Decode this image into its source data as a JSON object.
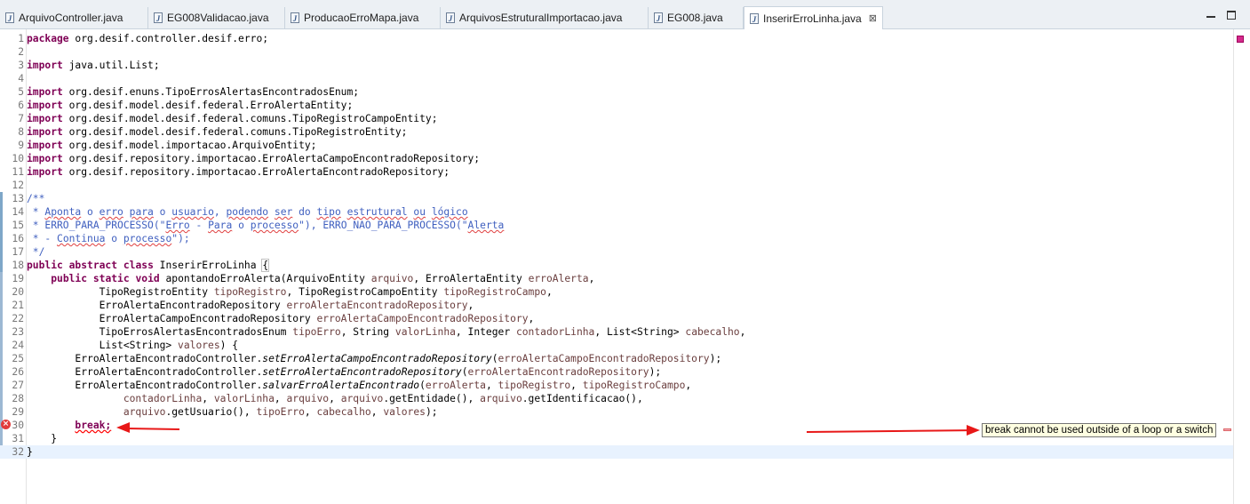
{
  "tabs": [
    {
      "label": "ArquivoController.java",
      "icon": "java-file-icon",
      "active": false
    },
    {
      "label": "EG008Validacao.java",
      "icon": "java-file-icon",
      "active": false
    },
    {
      "label": "ProducaoErroMapa.java",
      "icon": "java-file-icon",
      "active": false
    },
    {
      "label": "ArquivosEstruturalImportacao.java",
      "icon": "java-file-icon",
      "active": false
    },
    {
      "label": "EG008.java",
      "icon": "java-file-icon",
      "active": false
    },
    {
      "label": "InserirErroLinha.java",
      "icon": "java-file-icon",
      "active": true,
      "close": "⊠"
    }
  ],
  "editor": {
    "error_line": 30,
    "error_tooltip": "break cannot be used outside of a loop or a switch",
    "lines": [
      [
        [
          "kw",
          "package"
        ],
        [
          "t",
          " org.desif.controller.desif.erro;"
        ]
      ],
      [],
      [
        [
          "kw",
          "import"
        ],
        [
          "t",
          " java.util.List;"
        ]
      ],
      [],
      [
        [
          "kw",
          "import"
        ],
        [
          "t",
          " org.desif.enuns.TipoErrosAlertasEncontradosEnum;"
        ]
      ],
      [
        [
          "kw",
          "import"
        ],
        [
          "t",
          " org.desif.model.desif.federal.ErroAlertaEntity;"
        ]
      ],
      [
        [
          "kw",
          "import"
        ],
        [
          "t",
          " org.desif.model.desif.federal.comuns.TipoRegistroCampoEntity;"
        ]
      ],
      [
        [
          "kw",
          "import"
        ],
        [
          "t",
          " org.desif.model.desif.federal.comuns.TipoRegistroEntity;"
        ]
      ],
      [
        [
          "kw",
          "import"
        ],
        [
          "t",
          " org.desif.model.importacao.ArquivoEntity;"
        ]
      ],
      [
        [
          "kw",
          "import"
        ],
        [
          "t",
          " org.desif.repository.importacao.ErroAlertaCampoEncontradoRepository;"
        ]
      ],
      [
        [
          "kw",
          "import"
        ],
        [
          "t",
          " org.desif.repository.importacao.ErroAlertaEncontradoRepository;"
        ]
      ],
      [],
      [
        [
          "cm",
          "/**"
        ]
      ],
      [
        [
          "cm",
          " * "
        ],
        [
          "cms",
          "Aponta"
        ],
        [
          "cm",
          " o "
        ],
        [
          "cms",
          "erro"
        ],
        [
          "cm",
          " "
        ],
        [
          "cms",
          "para"
        ],
        [
          "cm",
          " o "
        ],
        [
          "cms",
          "usuario"
        ],
        [
          "cm",
          ", "
        ],
        [
          "cms",
          "podendo"
        ],
        [
          "cm",
          " "
        ],
        [
          "cms",
          "ser"
        ],
        [
          "cm",
          " do "
        ],
        [
          "cms",
          "tipo"
        ],
        [
          "cm",
          " "
        ],
        [
          "cms",
          "estrutural"
        ],
        [
          "cm",
          " "
        ],
        [
          "cms",
          "ou"
        ],
        [
          "cm",
          " "
        ],
        [
          "cms",
          "lógico"
        ]
      ],
      [
        [
          "cm",
          " * ERRO_PARA_PROCESSO(\""
        ],
        [
          "cms",
          "Erro"
        ],
        [
          "cm",
          " - "
        ],
        [
          "cms",
          "Para"
        ],
        [
          "cm",
          " o "
        ],
        [
          "cms",
          "processo"
        ],
        [
          "cm",
          "\"), ERRO_NAO_PARA_PROCESSO(\""
        ],
        [
          "cms",
          "Alerta"
        ]
      ],
      [
        [
          "cm",
          " * - "
        ],
        [
          "cms",
          "Continua"
        ],
        [
          "cm",
          " o "
        ],
        [
          "cms",
          "processo"
        ],
        [
          "cm",
          "\");"
        ]
      ],
      [
        [
          "cm",
          " */"
        ]
      ],
      [
        [
          "kw",
          "public"
        ],
        [
          "t",
          " "
        ],
        [
          "kw",
          "abstract"
        ],
        [
          "t",
          " "
        ],
        [
          "kw",
          "class"
        ],
        [
          "t",
          " InserirErroLinha "
        ],
        [
          "box",
          "{"
        ]
      ],
      [
        [
          "t",
          "    "
        ],
        [
          "kw",
          "public"
        ],
        [
          "t",
          " "
        ],
        [
          "kw",
          "static"
        ],
        [
          "t",
          " "
        ],
        [
          "kw",
          "void"
        ],
        [
          "t",
          " apontandoErroAlerta(ArquivoEntity "
        ],
        [
          "par",
          "arquivo"
        ],
        [
          "t",
          ", ErroAlertaEntity "
        ],
        [
          "par",
          "erroAlerta"
        ],
        [
          "t",
          ","
        ]
      ],
      [
        [
          "t",
          "            TipoRegistroEntity "
        ],
        [
          "par",
          "tipoRegistro"
        ],
        [
          "t",
          ", TipoRegistroCampoEntity "
        ],
        [
          "par",
          "tipoRegistroCampo"
        ],
        [
          "t",
          ","
        ]
      ],
      [
        [
          "t",
          "            ErroAlertaEncontradoRepository "
        ],
        [
          "par",
          "erroAlertaEncontradoRepository"
        ],
        [
          "t",
          ","
        ]
      ],
      [
        [
          "t",
          "            ErroAlertaCampoEncontradoRepository "
        ],
        [
          "par",
          "erroAlertaCampoEncontradoRepository"
        ],
        [
          "t",
          ","
        ]
      ],
      [
        [
          "t",
          "            TipoErrosAlertasEncontradosEnum "
        ],
        [
          "par",
          "tipoErro"
        ],
        [
          "t",
          ", String "
        ],
        [
          "par",
          "valorLinha"
        ],
        [
          "t",
          ", Integer "
        ],
        [
          "par",
          "contadorLinha"
        ],
        [
          "t",
          ", List<String> "
        ],
        [
          "par",
          "cabecalho"
        ],
        [
          "t",
          ","
        ]
      ],
      [
        [
          "t",
          "            List<String> "
        ],
        [
          "par",
          "valores"
        ],
        [
          "t",
          ") {"
        ]
      ],
      [
        [
          "t",
          "        ErroAlertaEncontradoController."
        ],
        [
          "ita",
          "setErroAlertaCampoEncontradoRepository"
        ],
        [
          "t",
          "("
        ],
        [
          "par",
          "erroAlertaCampoEncontradoRepository"
        ],
        [
          "t",
          ");"
        ]
      ],
      [
        [
          "t",
          "        ErroAlertaEncontradoController."
        ],
        [
          "ita",
          "setErroAlertaEncontradoRepository"
        ],
        [
          "t",
          "("
        ],
        [
          "par",
          "erroAlertaEncontradoRepository"
        ],
        [
          "t",
          ");"
        ]
      ],
      [
        [
          "t",
          "        ErroAlertaEncontradoController."
        ],
        [
          "ita",
          "salvarErroAlertaEncontrado"
        ],
        [
          "t",
          "("
        ],
        [
          "par",
          "erroAlerta"
        ],
        [
          "t",
          ", "
        ],
        [
          "par",
          "tipoRegistro"
        ],
        [
          "t",
          ", "
        ],
        [
          "par",
          "tipoRegistroCampo"
        ],
        [
          "t",
          ","
        ]
      ],
      [
        [
          "t",
          "                "
        ],
        [
          "par",
          "contadorLinha"
        ],
        [
          "t",
          ", "
        ],
        [
          "par",
          "valorLinha"
        ],
        [
          "t",
          ", "
        ],
        [
          "par",
          "arquivo"
        ],
        [
          "t",
          ", "
        ],
        [
          "par",
          "arquivo"
        ],
        [
          "t",
          ".getEntidade(), "
        ],
        [
          "par",
          "arquivo"
        ],
        [
          "t",
          ".getIdentificacao(),"
        ]
      ],
      [
        [
          "t",
          "                "
        ],
        [
          "par",
          "arquivo"
        ],
        [
          "t",
          ".getUsuario(), "
        ],
        [
          "par",
          "tipoErro"
        ],
        [
          "t",
          ", "
        ],
        [
          "par",
          "cabecalho"
        ],
        [
          "t",
          ", "
        ],
        [
          "par",
          "valores"
        ],
        [
          "t",
          ");"
        ]
      ],
      [
        [
          "t",
          "        "
        ],
        [
          "kwerr",
          "break;"
        ]
      ],
      [
        [
          "t",
          "    }"
        ]
      ],
      [
        [
          "t",
          "}"
        ]
      ]
    ]
  },
  "colors": {
    "keyword": "#7f0055",
    "comment": "#3f5fbf",
    "parameter": "#6a3e3e",
    "error": "#e81818",
    "current_line": "#e8f2fe",
    "tooltip_bg": "#ffffe1"
  }
}
